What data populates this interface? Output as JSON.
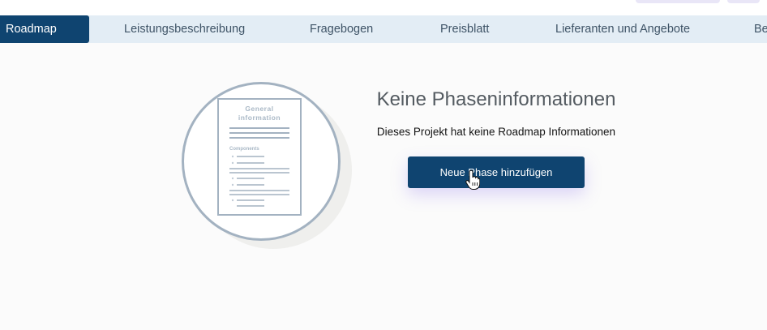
{
  "tabs": [
    {
      "label": "Roadmap",
      "active": true
    },
    {
      "label": "Leistungsbeschreibung",
      "active": false
    },
    {
      "label": "Fragebogen",
      "active": false
    },
    {
      "label": "Preisblatt",
      "active": false
    },
    {
      "label": "Lieferanten und Angebote",
      "active": false
    },
    {
      "label": "Be",
      "active": false
    }
  ],
  "illustration": {
    "heading": "General information",
    "heading_line1": "General",
    "heading_line2": "information",
    "section_label": "Components"
  },
  "empty_state": {
    "title": "Keine Phaseninformationen",
    "description": "Dieses Projekt hat keine Roadmap Informationen",
    "button_label": "Neue Phase hinzufügen"
  },
  "colors": {
    "primary": "#0f4470",
    "tabbar_bg": "#e3edf5",
    "tab_text": "#3e5366",
    "illustration_stroke": "#a3b2c1",
    "button_shadow": "#8064eb"
  },
  "icons": {
    "pointer": "hand-pointer-icon"
  }
}
